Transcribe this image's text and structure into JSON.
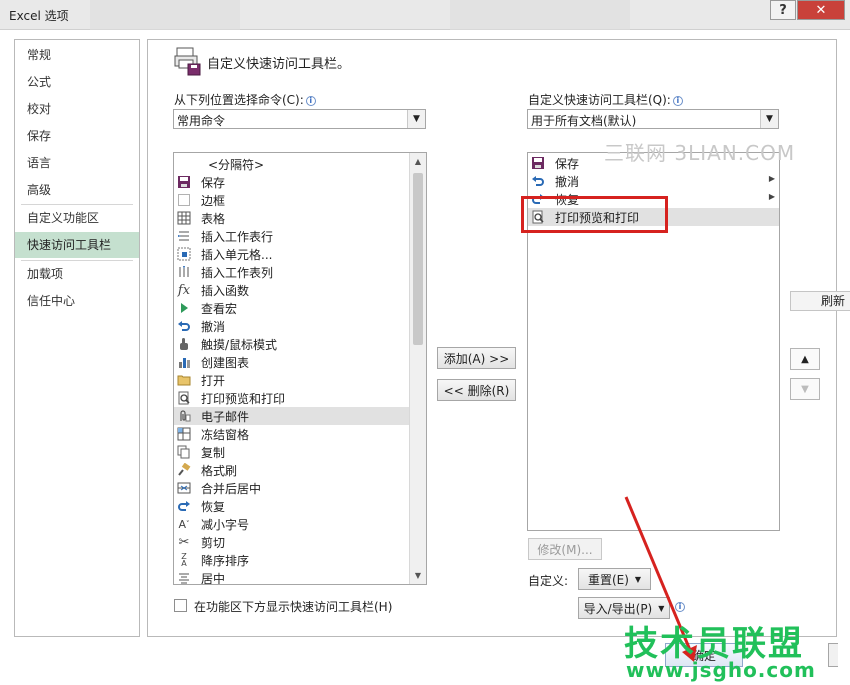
{
  "window": {
    "title": "Excel 选项",
    "help_label": "?",
    "close_label": "✕"
  },
  "nav": {
    "items": [
      {
        "label": "常规"
      },
      {
        "label": "公式"
      },
      {
        "label": "校对"
      },
      {
        "label": "保存"
      },
      {
        "label": "语言"
      },
      {
        "label": "高级"
      },
      {
        "label": "自定义功能区"
      },
      {
        "label": "快速访问工具栏",
        "selected": true
      },
      {
        "label": "加载项"
      },
      {
        "label": "信任中心"
      }
    ]
  },
  "main": {
    "heading": "自定义快速访问工具栏。",
    "left": {
      "choose_label": "从下列位置选择命令(C):",
      "choose_value": "常用命令",
      "commands": [
        {
          "label": "<分隔符>",
          "icon": "separator-icon",
          "submenu": false
        },
        {
          "label": "保存",
          "icon": "save-icon",
          "submenu": false
        },
        {
          "label": "边框",
          "icon": "border-icon",
          "submenu": true
        },
        {
          "label": "表格",
          "icon": "table-icon",
          "submenu": false
        },
        {
          "label": "插入工作表行",
          "icon": "insert-row-icon",
          "submenu": false
        },
        {
          "label": "插入单元格...",
          "icon": "insert-cells-icon",
          "submenu": false
        },
        {
          "label": "插入工作表列",
          "icon": "insert-column-icon",
          "submenu": false
        },
        {
          "label": "插入函数",
          "icon": "function-icon",
          "submenu": false
        },
        {
          "label": "查看宏",
          "icon": "macro-icon",
          "submenu": false
        },
        {
          "label": "撤消",
          "icon": "undo-icon",
          "submenu": true
        },
        {
          "label": "触摸/鼠标模式",
          "icon": "touch-mode-icon",
          "submenu": true
        },
        {
          "label": "创建图表",
          "icon": "chart-icon",
          "submenu": false
        },
        {
          "label": "打开",
          "icon": "open-folder-icon",
          "submenu": false
        },
        {
          "label": "打印预览和打印",
          "icon": "print-preview-icon",
          "submenu": false
        },
        {
          "label": "电子邮件",
          "icon": "email-icon",
          "submenu": false,
          "highlighted": true
        },
        {
          "label": "冻结窗格",
          "icon": "freeze-panes-icon",
          "submenu": true
        },
        {
          "label": "复制",
          "icon": "copy-icon",
          "submenu": false
        },
        {
          "label": "格式刷",
          "icon": "format-painter-icon",
          "submenu": false
        },
        {
          "label": "合并后居中",
          "icon": "merge-center-icon",
          "submenu": false
        },
        {
          "label": "恢复",
          "icon": "redo-icon",
          "submenu": true
        },
        {
          "label": "减小字号",
          "icon": "font-shrink-icon",
          "submenu": false
        },
        {
          "label": "剪切",
          "icon": "cut-icon",
          "submenu": false
        },
        {
          "label": "降序排序",
          "icon": "sort-descending-icon",
          "submenu": false
        },
        {
          "label": "居中",
          "icon": "align-center-icon",
          "submenu": false
        }
      ],
      "show_below_label": "在功能区下方显示快速访问工具栏(H)",
      "show_below_checked": false
    },
    "right": {
      "customize_label": "自定义快速访问工具栏(Q):",
      "customize_value": "用于所有文档(默认)",
      "items": [
        {
          "label": "保存",
          "icon": "save-icon",
          "submenu": false
        },
        {
          "label": "撤消",
          "icon": "undo-icon",
          "submenu": true
        },
        {
          "label": "恢复",
          "icon": "redo-icon",
          "submenu": true
        },
        {
          "label": "打印预览和打印",
          "icon": "print-preview-icon",
          "submenu": false,
          "highlighted": true
        }
      ],
      "modify_label": "修改(M)...",
      "custom_label": "自定义:",
      "reset_label": "重置(E)",
      "import_export_label": "导入/导出(P)"
    },
    "add_label": "添加(A) >>",
    "remove_label": "<< 删除(R)",
    "refresh_label": "刷新",
    "ok_label": "确定"
  },
  "watermark": {
    "text": "三联网 3LIAN.COM"
  },
  "logo_watermark": {
    "title": "技术员联盟",
    "url": "www.jsgho.com"
  },
  "colors": {
    "selected_nav": "#c5e0cf",
    "annotation_red": "#d6221f",
    "logo_green": "#21c05a"
  }
}
